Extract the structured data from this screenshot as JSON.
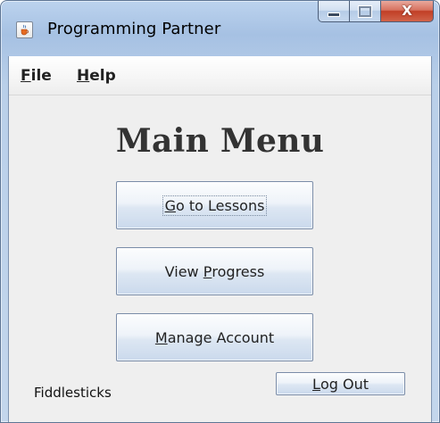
{
  "window": {
    "title": "Programming Partner",
    "icon": "java-cup-icon",
    "close_glyph": "X"
  },
  "menubar": {
    "file": {
      "mnemonic": "F",
      "rest": "ile"
    },
    "help": {
      "mnemonic": "H",
      "rest": "elp"
    }
  },
  "main": {
    "heading": "Main Menu",
    "buttons": {
      "lessons": {
        "mnemonic": "G",
        "rest": "o to Lessons"
      },
      "progress": {
        "before": "View ",
        "mnemonic": "P",
        "rest": "rogress"
      },
      "account": {
        "mnemonic": "M",
        "rest": "anage Account"
      }
    }
  },
  "footer": {
    "username": "Fiddlesticks",
    "logout": {
      "mnemonic": "L",
      "rest": "og Out"
    }
  },
  "colors": {
    "client_bg": "#efefef",
    "heading": "#333333",
    "close_button": "#c13f26"
  }
}
